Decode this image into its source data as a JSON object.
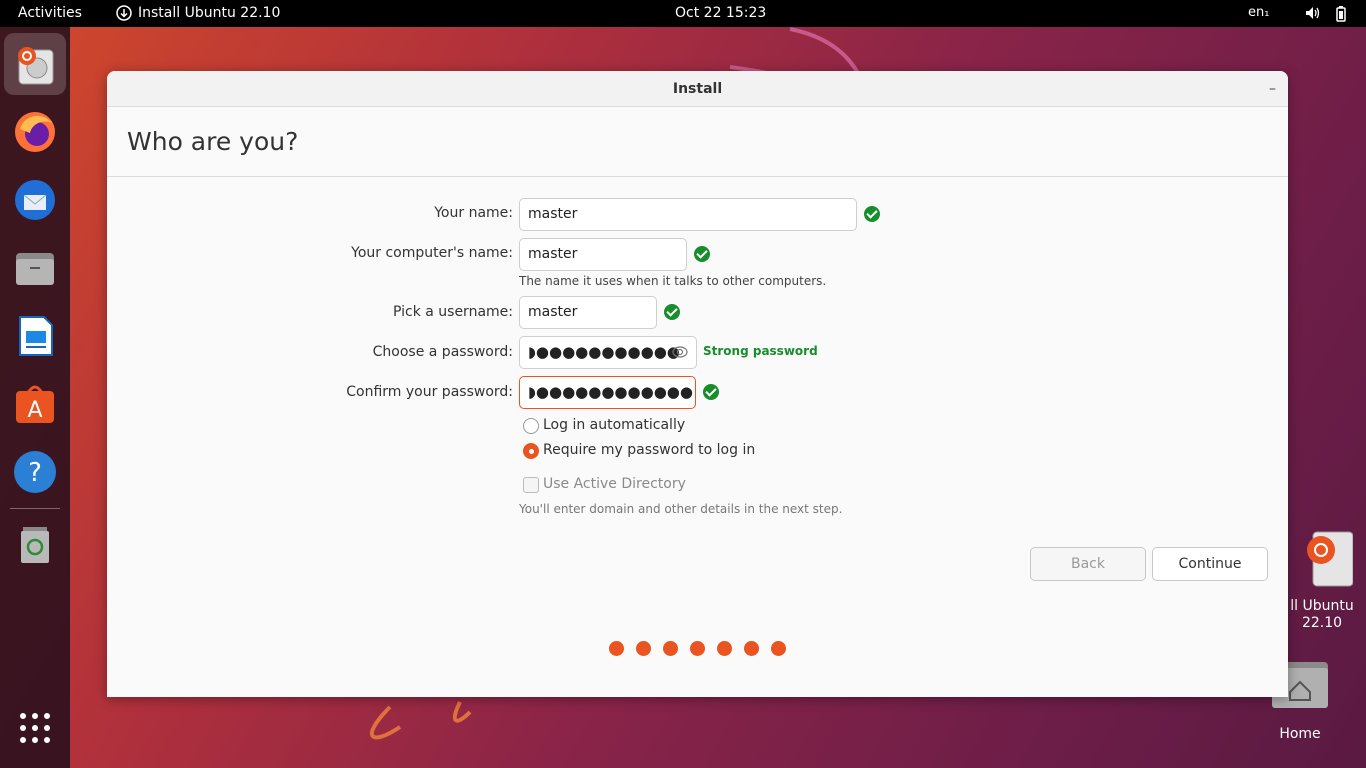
{
  "topbar": {
    "activities": "Activities",
    "app_name": "Install Ubuntu 22.10",
    "clock": "Oct 22  15:23",
    "language": "en₁",
    "icons": [
      "download-icon",
      "volume-icon",
      "battery-icon"
    ]
  },
  "dock": {
    "items": [
      "ubuntu-installer-icon",
      "firefox-icon",
      "thunderbird-icon",
      "files-icon",
      "libreoffice-writer-icon",
      "ubuntu-software-icon",
      "help-icon",
      "trash-icon"
    ],
    "show_apps_icon": "app-grid-icon"
  },
  "desktop": {
    "icons": [
      {
        "label": "ll Ubuntu\n22.10",
        "icon": "ubuntu-installer-icon"
      },
      {
        "label": "Home",
        "icon": "home-folder-icon"
      }
    ]
  },
  "window": {
    "title": "Install",
    "minimize_label": "–",
    "page_title": "Who are you?",
    "form": {
      "your_name": {
        "label": "Your name:",
        "value": "master",
        "valid": true
      },
      "computer_name": {
        "label": "Your computer's name:",
        "value": "master",
        "valid": true,
        "hint": "The name it uses when it talks to other computers."
      },
      "username": {
        "label": "Pick a username:",
        "value": "master",
        "valid": true
      },
      "password": {
        "label": "Choose a password:",
        "value": "◗●●●●●●●●●●●",
        "strength": "Strong password"
      },
      "confirm_password": {
        "label": "Confirm your password:",
        "value": "◗●●●●●●●●●●●●",
        "valid": true
      }
    },
    "login_options": [
      {
        "label": "Log in automatically",
        "selected": false
      },
      {
        "label": "Require my password to log in",
        "selected": true
      }
    ],
    "active_directory": {
      "label": "Use Active Directory",
      "checked": false,
      "enabled": false,
      "hint": "You'll enter domain and other details in the next step."
    },
    "buttons": {
      "back": "Back",
      "continue": "Continue"
    },
    "progress": {
      "steps": 7,
      "completed": 7
    },
    "colors": {
      "accent": "#e95420",
      "valid": "#188d2c"
    }
  }
}
